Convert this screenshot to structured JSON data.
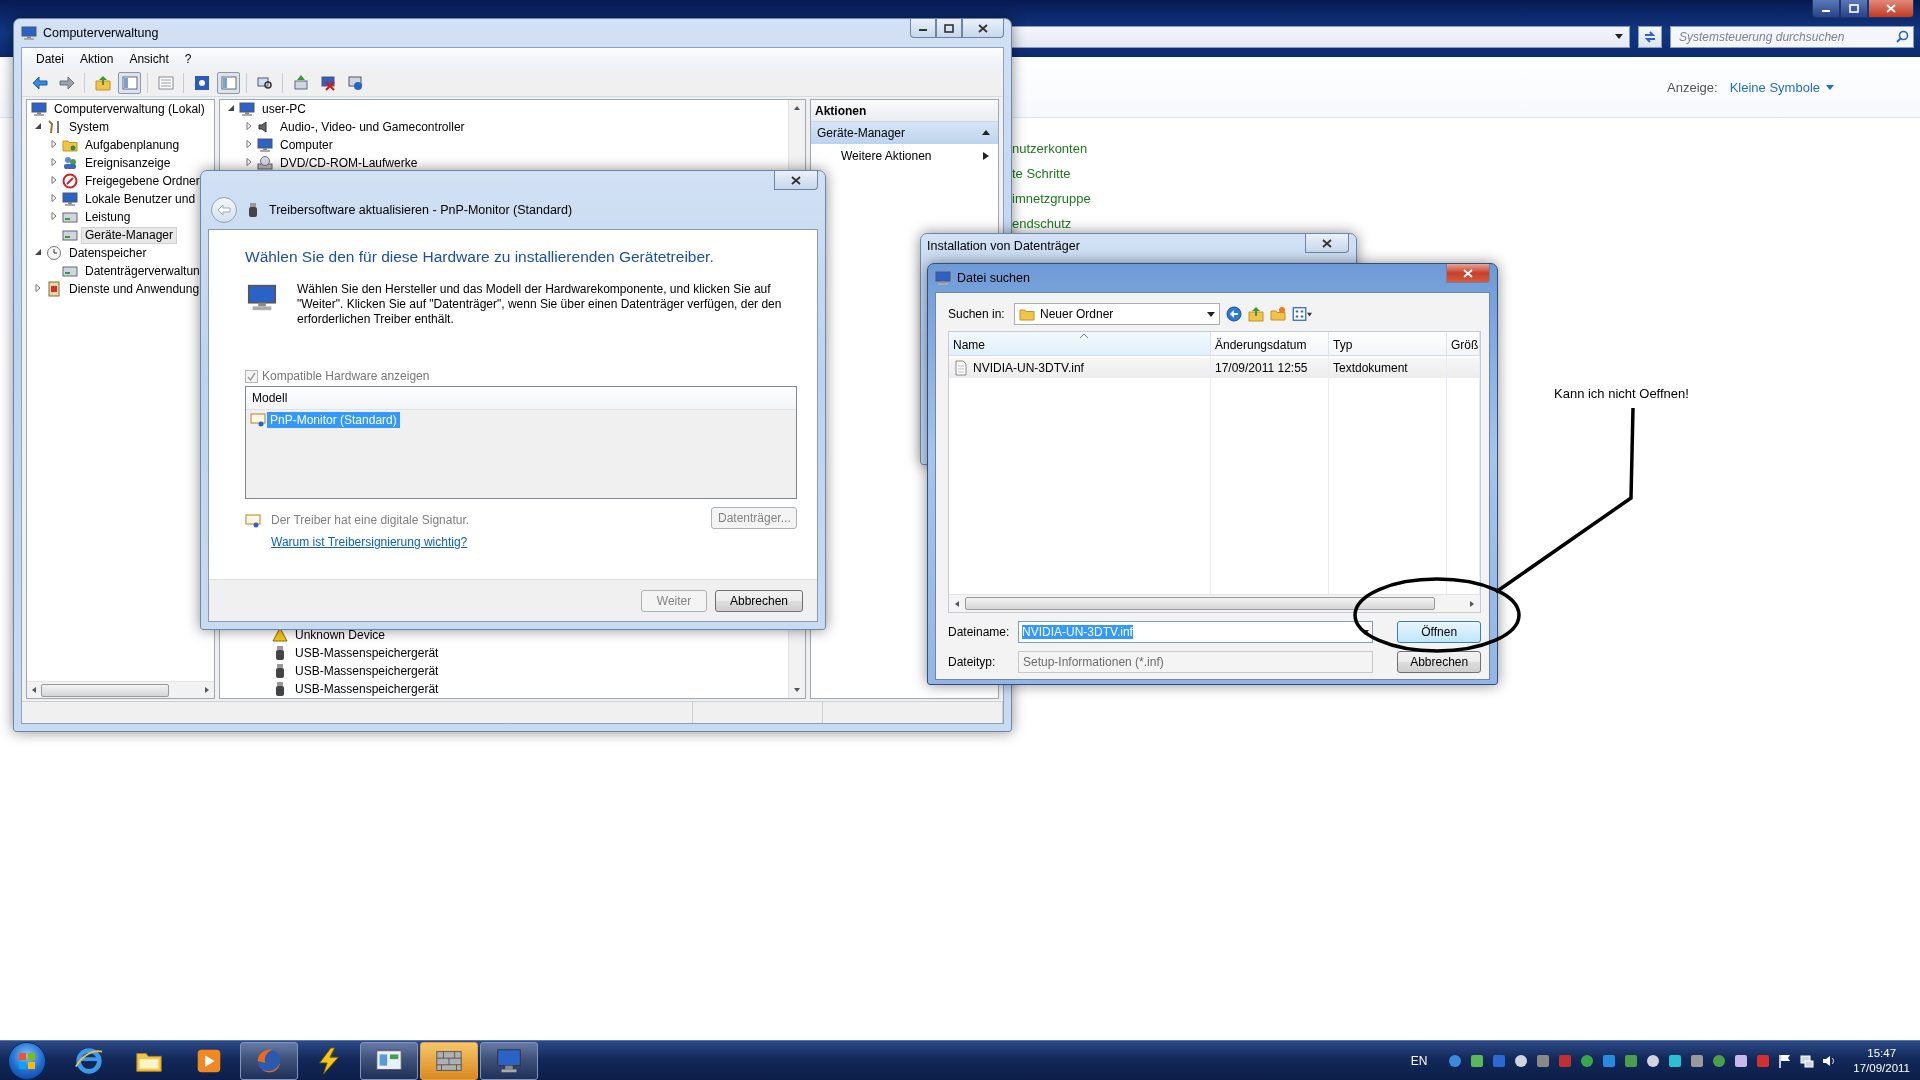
{
  "control_panel": {
    "search": {
      "placeholder": "Systemsteuerung durchsuchen"
    },
    "view_label": "Anzeige:",
    "view_value": "Kleine Symbole",
    "links": [
      "nutzerkonten",
      "te Schritte",
      "imnetzgruppe",
      "endschutz"
    ]
  },
  "computer_management": {
    "title": "Computerverwaltung",
    "menu": [
      "Datei",
      "Aktion",
      "Ansicht",
      "?"
    ],
    "tree": [
      {
        "label": "Computerverwaltung (Lokal)",
        "selected": false,
        "children": [
          {
            "label": "System",
            "kind": "branch",
            "expanded": true,
            "selected": false,
            "children": [
              {
                "label": "Aufgabenplanung",
                "kind": "branch",
                "expanded": false,
                "selected": false
              },
              {
                "label": "Ereignisanzeige",
                "kind": "branch",
                "expanded": false,
                "selected": false
              },
              {
                "label": "Freigegebene Ordner",
                "kind": "branch",
                "expanded": false,
                "selected": false
              },
              {
                "label": "Lokale Benutzer und",
                "kind": "branch",
                "expanded": false,
                "selected": false
              },
              {
                "label": "Leistung",
                "kind": "branch",
                "expanded": false,
                "selected": false
              },
              {
                "label": "Geräte-Manager",
                "kind": "plain",
                "selected": true
              }
            ]
          },
          {
            "label": "Datenspeicher",
            "kind": "branch",
            "expanded": true,
            "selected": false,
            "children": [
              {
                "label": "Datenträgerverwaltun",
                "kind": "plain",
                "selected": false
              }
            ]
          },
          {
            "label": "Dienste und Anwendung",
            "kind": "branch",
            "expanded": false,
            "selected": false
          }
        ]
      }
    ],
    "devices": {
      "root": {
        "label": "user-PC",
        "expanded": true
      },
      "top": [
        {
          "label": "Audio-, Video- und Gamecontroller",
          "kind": "speaker",
          "expanded": false
        },
        {
          "label": "Computer",
          "kind": "monitor",
          "expanded": false
        },
        {
          "label": "DVD/CD-ROM-Laufwerke",
          "kind": "disc",
          "expanded": false
        }
      ],
      "bottom": [
        {
          "label": "Unknown Device",
          "kind": "warning"
        },
        {
          "label": "USB-Massenspeichergerät",
          "kind": "usb"
        },
        {
          "label": "USB-Massenspeichergerät",
          "kind": "usb"
        },
        {
          "label": "USB-Massenspeichergerät",
          "kind": "usb"
        }
      ]
    },
    "actions": {
      "title": "Aktionen",
      "section": "Geräte-Manager",
      "more": "Weitere Aktionen"
    }
  },
  "driver_wizard": {
    "title": "Treibersoftware aktualisieren - PnP-Monitor (Standard)",
    "heading": "Wählen Sie den für diese Hardware zu installierenden Gerätetreiber.",
    "description": "Wählen Sie den Hersteller und das Modell der Hardwarekomponente, und klicken Sie auf \"Weiter\". Klicken Sie auf \"Datenträger\", wenn Sie über einen Datenträger verfügen, der den erforderlichen Treiber enthält.",
    "compatible": {
      "label": "Kompatible Hardware anzeigen",
      "checked": true,
      "disabled": true
    },
    "list_header": "Modell",
    "models": [
      {
        "label": "PnP-Monitor (Standard)",
        "selected": true
      }
    ],
    "signature": "Der Treiber hat eine digitale Signatur.",
    "disk_button": {
      "label": "Datenträger...",
      "disabled": true
    },
    "link": "Warum ist Treibersignierung wichtig?",
    "buttons": [
      {
        "label": "Weiter",
        "disabled": true
      },
      {
        "label": "Abbrechen",
        "disabled": false
      }
    ]
  },
  "install_dialog": {
    "title": "Installation von Datenträger"
  },
  "file_dialog": {
    "title": "Datei suchen",
    "look_in_label": "Suchen in:",
    "look_in": "Neuer Ordner",
    "columns": [
      {
        "label": "Name",
        "sorted": true
      },
      {
        "label": "Änderungsdatum",
        "sorted": false
      },
      {
        "label": "Typ",
        "sorted": false
      },
      {
        "label": "Größ",
        "sorted": false
      }
    ],
    "files": [
      {
        "cells": [
          "NVIDIA-UN-3DTV.inf",
          "17/09/2011 12:55",
          "Textdokument"
        ]
      }
    ],
    "filename_label": "Dateiname:",
    "filename": "NVIDIA-UN-3DTV.inf",
    "filename_selected": true,
    "filetype_label": "Dateityp:",
    "filetype": "Setup-Informationen (*.inf)",
    "buttons": [
      "Öffnen",
      "Abbrechen"
    ]
  },
  "annotation": {
    "text": "Kann ich nicht Oeffnen!"
  },
  "taskbar": {
    "apps": [
      {
        "kind": "browser",
        "running": false,
        "highlighted": false
      },
      {
        "kind": "explorer",
        "running": false,
        "highlighted": false
      },
      {
        "kind": "media",
        "running": false,
        "highlighted": false
      },
      {
        "kind": "firefox",
        "running": true,
        "highlighted": false
      },
      {
        "kind": "lightning",
        "running": false,
        "highlighted": false
      },
      {
        "kind": "panel",
        "running": true,
        "highlighted": false
      },
      {
        "kind": "wall",
        "running": true,
        "highlighted": true
      },
      {
        "kind": "computer",
        "running": true,
        "highlighted": false
      }
    ],
    "language": "EN",
    "time": "15:47",
    "date": "17/09/2011"
  }
}
